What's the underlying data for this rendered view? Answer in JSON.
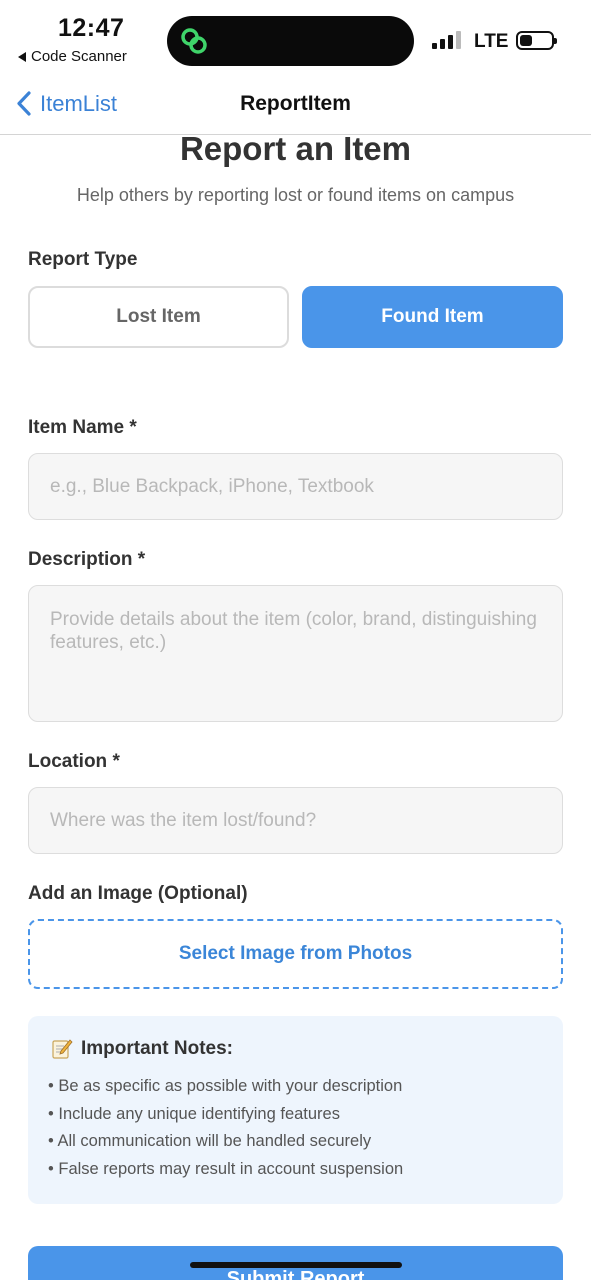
{
  "status": {
    "time": "12:47",
    "back_app": "Code Scanner",
    "network": "LTE"
  },
  "nav": {
    "back_label": "ItemList",
    "title": "ReportItem"
  },
  "page": {
    "title": "Report an Item",
    "subtitle": "Help others by reporting lost or found items on campus"
  },
  "report_type": {
    "label": "Report Type",
    "lost": "Lost Item",
    "found": "Found Item",
    "selected": "Found Item"
  },
  "item_name": {
    "label": "Item Name *",
    "placeholder": "e.g., Blue Backpack, iPhone, Textbook"
  },
  "description": {
    "label": "Description *",
    "placeholder": "Provide details about the item (color, brand, distinguishing features, etc.)"
  },
  "location": {
    "label": "Location *",
    "placeholder": "Where was the item lost/found?"
  },
  "image": {
    "label": "Add an Image (Optional)",
    "button": "Select Image from Photos"
  },
  "notes": {
    "title": "Important Notes:",
    "items": [
      "• Be as specific as possible with your description",
      "• Include any unique identifying features",
      "• All communication will be handled securely",
      "• False reports may result in account suspension"
    ]
  },
  "submit": {
    "label": "Submit Report"
  },
  "colors": {
    "accent": "#4a95e9",
    "link": "#3b82d6",
    "notes_bg": "#eef5fd"
  }
}
